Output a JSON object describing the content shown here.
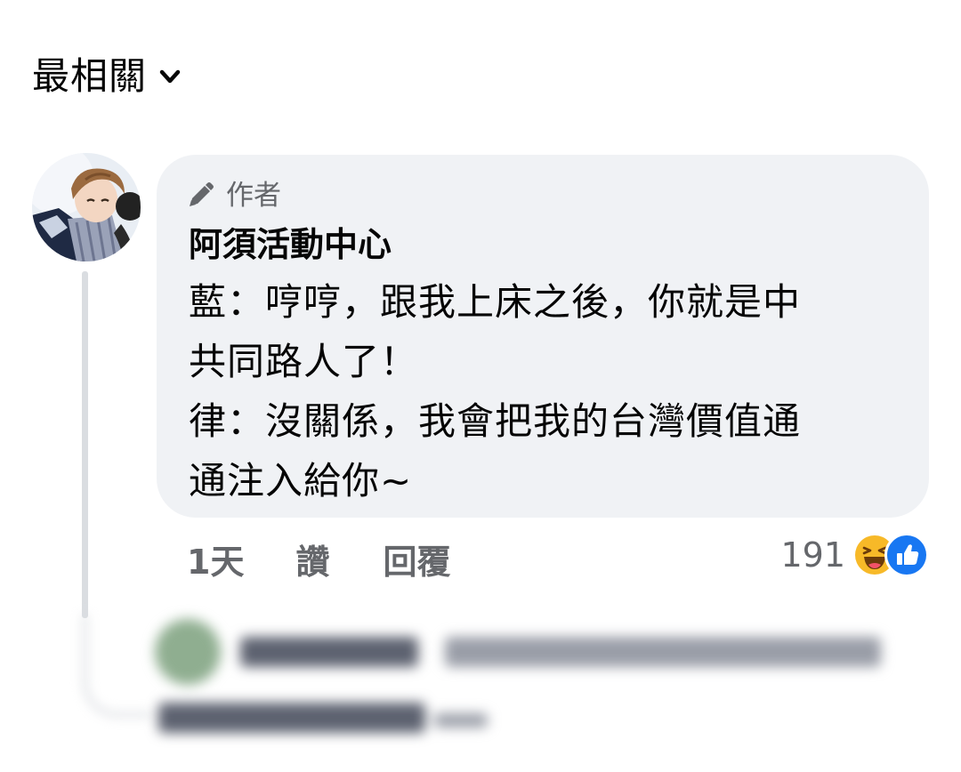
{
  "sort": {
    "label": "最相關",
    "icon": "chevron-down-icon"
  },
  "comment": {
    "badge": {
      "icon": "pencil-icon",
      "label": "作者"
    },
    "author_name": "阿須活動中心",
    "text": "藍：哼哼，跟我上床之後，你就是中\n共同路人了！\n律：沒關係，我會把我的台灣價值通\n通注入給你~",
    "time": "1天",
    "like_label": "讚",
    "reply_label": "回覆",
    "reaction_count": "191",
    "reaction_icons": [
      "haha-icon",
      "like-icon"
    ]
  },
  "colors": {
    "bubble_bg": "#f0f2f5",
    "secondary_text": "#65676b",
    "like_blue": "#1877f2",
    "haha_yellow": "#f7b928"
  }
}
